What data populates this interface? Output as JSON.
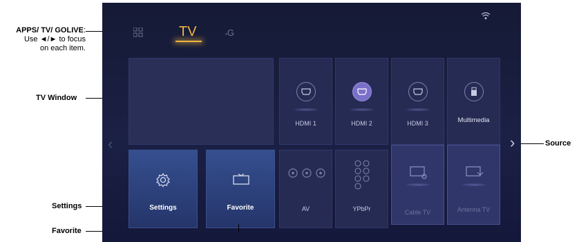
{
  "annotations": {
    "apps_title": "APPS/ TV/ GOLIVE",
    "apps_desc_1": "Use ◄/► to focus",
    "apps_desc_2": "on each item.",
    "tv_window": "TV Window",
    "settings": "Settings",
    "favorite": "Favorite",
    "source": "Source"
  },
  "tabs": {
    "apps_icon": "apps-grid-icon",
    "tv": "TV",
    "golive": "G"
  },
  "sources_row1": [
    {
      "label": "HDMI 1",
      "icon": "hdmi-icon",
      "selected": false
    },
    {
      "label": "HDMI 2",
      "icon": "hdmi-icon",
      "selected": true
    },
    {
      "label": "HDMI 3",
      "icon": "hdmi-icon",
      "selected": false
    },
    {
      "label": "Multimedia",
      "icon": "usb-icon",
      "selected": false
    }
  ],
  "bottom_row": {
    "settings": "Settings",
    "favorite": "Favorite",
    "av": "AV",
    "ypbpr": "YPbPr",
    "cable_tv": "Cable TV",
    "antenna_tv": "Antenna TV"
  },
  "colors": {
    "accent": "#f0b640",
    "selected": "#7a70c9",
    "background": "#181c3d"
  }
}
